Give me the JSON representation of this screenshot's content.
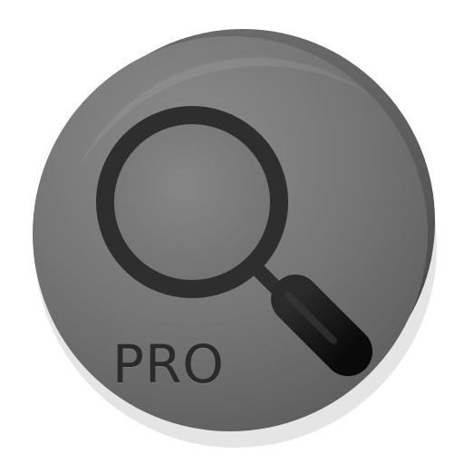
{
  "app_icon": {
    "label": "PRO",
    "icon": "magnifying-glass-icon",
    "colors": {
      "disc_light": "#8a8a8a",
      "disc_mid": "#747474",
      "disc_dark": "#5c5c5c",
      "disc_rim": "#4a4a4a",
      "disc_shadow": "#3a3a3a",
      "lens_ring": "#2e2e2e",
      "handle": "#151515",
      "text": "#2a2a2a"
    }
  }
}
